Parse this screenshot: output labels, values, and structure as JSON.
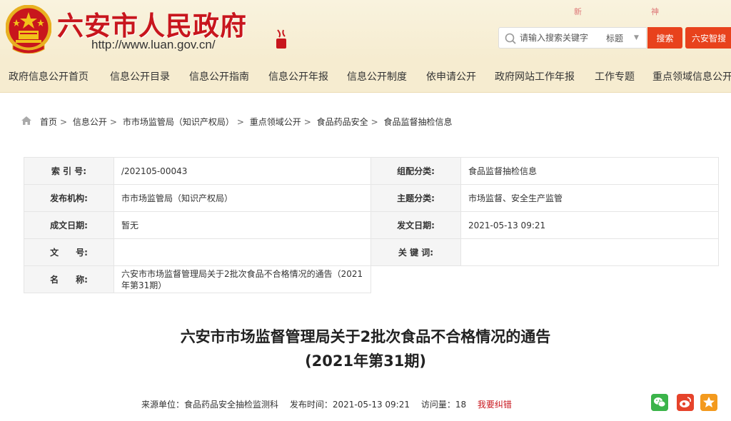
{
  "header": {
    "site_title": "六安市人民政府",
    "site_url": "http://www.luan.gov.cn/",
    "seal_text": "大美六安",
    "decor_left": "新",
    "decor_right": "神",
    "search": {
      "placeholder": "请输入搜索关键字",
      "scope": "标题",
      "search_button": "搜索",
      "smart_button": "六安智搜"
    },
    "colors": {
      "brand_red": "#c8161d",
      "button_orange": "#e8421c",
      "header_bg": "#f6ecd0"
    }
  },
  "nav": {
    "items": [
      "政府信息公开首页",
      "信息公开目录",
      "信息公开指南",
      "信息公开年报",
      "信息公开制度",
      "依申请公开",
      "政府网站工作年报",
      "工作专题",
      "重点领域信息公开"
    ]
  },
  "breadcrumb": {
    "home_icon": "home-icon",
    "items": [
      "首页",
      "信息公开",
      "市市场监管局（知识产权局）",
      "重点领域公开",
      "食品药品安全",
      "食品监督抽检信息"
    ],
    "separator": ">"
  },
  "info": {
    "index_label": "索 引 号:",
    "index_value": "/202105-00043",
    "category_label": "组配分类:",
    "category_value": "食品监督抽检信息",
    "publisher_label": "发布机构:",
    "publisher_value": "市市场监管局（知识产权局）",
    "topic_label": "主题分类:",
    "topic_value": "市场监督、安全生产监管",
    "created_label": "成文日期:",
    "created_value": "暂无",
    "issued_label": "发文日期:",
    "issued_value": "2021-05-13 09:21",
    "docno_label": "文　　号:",
    "docno_value": "",
    "keywords_label": "关 键 词:",
    "keywords_value": "",
    "name_label": "名　　称:",
    "name_value": "六安市市场监督管理局关于2批次食品不合格情况的通告（2021年第31期）"
  },
  "article": {
    "title_line1": "六安市市场监督管理局关于2批次食品不合格情况的通告",
    "title_line2": "(2021年第31期)",
    "source": "来源单位：食品药品安全抽检监测科",
    "publish_time": "发布时间：2021-05-13 09:21",
    "views": "访问量：18",
    "report_error": "我要纠错",
    "share_icons": [
      "wechat-icon",
      "weibo-icon",
      "favorite-icon"
    ]
  }
}
